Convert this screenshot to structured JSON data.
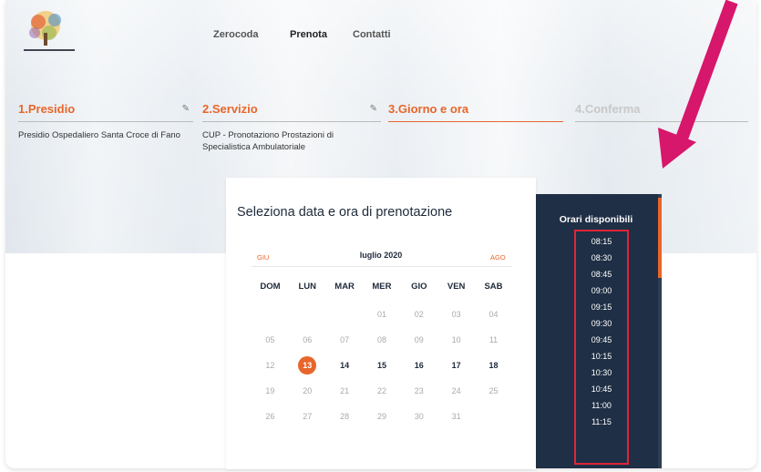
{
  "nav": {
    "items": [
      {
        "label": "Zerocoda"
      },
      {
        "label": "Prenota"
      },
      {
        "label": "Contatti"
      }
    ]
  },
  "steps": [
    {
      "title": "1.Presidio",
      "desc": "Presidio Ospedaliero Santa Croce di Fano"
    },
    {
      "title": "2.Servizio",
      "desc": "CUP - Pronotaziono Prostazioni di Specialistica Ambulatoriale"
    },
    {
      "title": "3.Giorno e ora"
    },
    {
      "title": "4.Conferma"
    }
  ],
  "calendar": {
    "title": "Seleziona data e ora di prenotazione",
    "prev_label": "GIU",
    "next_label": "AGO",
    "month_label": "luglio 2020",
    "weekdays": [
      "DOM",
      "LUN",
      "MAR",
      "MER",
      "GIO",
      "VEN",
      "SAB"
    ],
    "weeks": [
      [
        "",
        "",
        "",
        "01",
        "02",
        "03",
        "04"
      ],
      [
        "05",
        "06",
        "07",
        "08",
        "09",
        "10",
        "11"
      ],
      [
        "12",
        "13",
        "14",
        "15",
        "16",
        "17",
        "18"
      ],
      [
        "19",
        "20",
        "21",
        "22",
        "23",
        "24",
        "25"
      ],
      [
        "26",
        "27",
        "28",
        "29",
        "30",
        "31",
        ""
      ]
    ],
    "selected_day": "13",
    "available_days": [
      "14",
      "15",
      "16",
      "17",
      "18"
    ]
  },
  "orari": {
    "title": "Orari disponibili",
    "times": [
      "08:15",
      "08:30",
      "08:45",
      "09:00",
      "09:15",
      "09:30",
      "09:45",
      "10:15",
      "10:30",
      "10:45",
      "11:00",
      "11:15"
    ]
  },
  "colors": {
    "accent": "#e8662b",
    "panel": "#1f2f45",
    "annotation": "#e0253a",
    "arrow": "#d6176b"
  }
}
